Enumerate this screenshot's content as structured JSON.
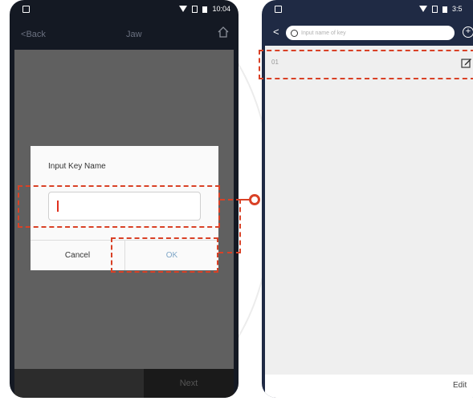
{
  "left_phone": {
    "status_time": "10:04",
    "nav": {
      "back_label": "Back",
      "title": "Jaw"
    },
    "dialog": {
      "title": "Input Key Name",
      "input_value": "",
      "cancel_label": "Cancel",
      "ok_label": "OK"
    },
    "bottom_next_label": "Next"
  },
  "right_phone": {
    "status_time": "3:5",
    "search": {
      "placeholder": "Input name of key"
    },
    "keys": [
      {
        "label": "01"
      }
    ],
    "footer_edit_label": "Edit"
  },
  "colors": {
    "callout": "#d94126",
    "ok_text": "#7fa6c7",
    "right_header": "#1f2a44"
  },
  "icons": [
    "home-icon",
    "back-chevron-icon",
    "search-icon",
    "add-circle-icon",
    "edit-icon",
    "wifi-icon",
    "battery-icon",
    "sim-icon"
  ]
}
